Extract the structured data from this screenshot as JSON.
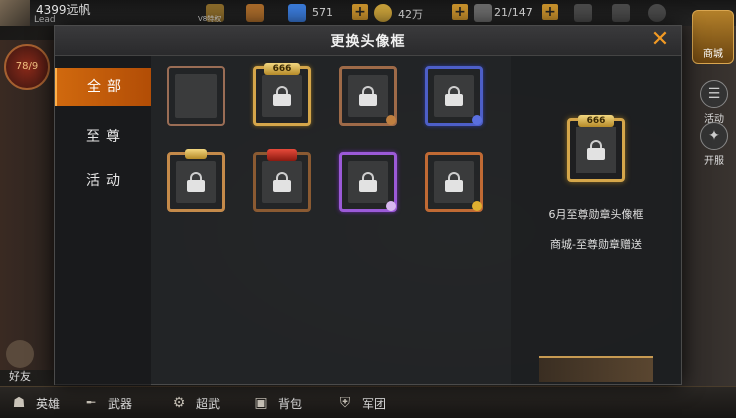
{
  "hud": {
    "player_name": "4399远帆",
    "player_level": "Lead",
    "vip_label": "V8特权",
    "gems": "571",
    "gold": "42万",
    "energy": "21/147"
  },
  "left_hud": {
    "rank": "78/9"
  },
  "right_hud": {
    "shop_label": "商城",
    "activity_label": "活动",
    "open_label": "开服"
  },
  "modal": {
    "title": "更换头像框",
    "tabs": [
      {
        "label": "全部",
        "active": true
      },
      {
        "label": "至尊",
        "active": false
      },
      {
        "label": "活动",
        "active": false
      }
    ],
    "frames": [
      {
        "id": "plain",
        "locked": false,
        "badge": ""
      },
      {
        "id": "gold-666",
        "locked": true,
        "badge": "666"
      },
      {
        "id": "bronze",
        "locked": true,
        "badge": ""
      },
      {
        "id": "blue",
        "locked": true,
        "badge": ""
      },
      {
        "id": "winged-gold",
        "locked": true,
        "badge": ""
      },
      {
        "id": "red-ornate",
        "locked": true,
        "badge": ""
      },
      {
        "id": "purple",
        "locked": true,
        "badge": ""
      },
      {
        "id": "copper",
        "locked": true,
        "badge": ""
      }
    ],
    "detail": {
      "badge": "666",
      "frame_name": "6月至尊勋章头像框",
      "source": "商城-至尊勋章赠送"
    }
  },
  "bottom_nav": {
    "friends": "好友",
    "items": [
      "英雄",
      "武器",
      "超武",
      "背包",
      "军团"
    ]
  },
  "colors": {
    "accent": "#d0690e",
    "close": "#f29a24",
    "gold_frame": "#d5a64a"
  }
}
